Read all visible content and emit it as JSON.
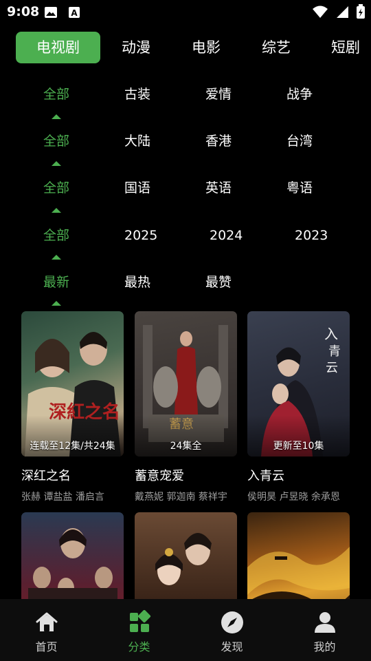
{
  "status_bar": {
    "time": "9:08",
    "left_icons": [
      "image-icon",
      "text-a-icon"
    ],
    "right_icons": [
      "wifi-icon",
      "signal-icon",
      "battery-icon"
    ]
  },
  "top_tabs": [
    {
      "label": "电视剧",
      "active": true
    },
    {
      "label": "动漫",
      "active": false
    },
    {
      "label": "电影",
      "active": false
    },
    {
      "label": "综艺",
      "active": false
    },
    {
      "label": "短剧",
      "active": false
    }
  ],
  "filters": [
    {
      "name": "genre",
      "options": [
        "全部",
        "古装",
        "爱情",
        "战争"
      ],
      "selected": 0
    },
    {
      "name": "region",
      "options": [
        "全部",
        "大陆",
        "香港",
        "台湾"
      ],
      "selected": 0
    },
    {
      "name": "language",
      "options": [
        "全部",
        "国语",
        "英语",
        "粤语"
      ],
      "selected": 0
    },
    {
      "name": "year",
      "options": [
        "全部",
        "2025",
        "2024",
        "2023"
      ],
      "selected": 0
    },
    {
      "name": "sort",
      "options": [
        "最新",
        "最热",
        "最赞"
      ],
      "selected": 0
    }
  ],
  "cards": [
    {
      "title": "深红之名",
      "badge": "连载至12集/共24集",
      "cast": "张赫  谭盐盐  潘启言",
      "colors": [
        "#3a5a4a",
        "#c8b8a0"
      ]
    },
    {
      "title": "蓄意宠爱",
      "badge": "24集全",
      "cast": "戴燕妮  郭迦南  蔡祥宇",
      "colors": [
        "#3b3532",
        "#7a2a2a"
      ]
    },
    {
      "title": "入青云",
      "badge": "更新至10集",
      "cast": "侯明昊  卢昱晓  余承恩",
      "colors": [
        "#2e3444",
        "#8a2a3a"
      ]
    },
    {
      "title": "",
      "badge": "",
      "cast": "",
      "colors": [
        "#2a3a50",
        "#a03030"
      ]
    },
    {
      "title": "",
      "badge": "",
      "cast": "",
      "colors": [
        "#5a3a2a",
        "#e8d0b0"
      ]
    },
    {
      "title": "",
      "badge": "",
      "cast": "",
      "colors": [
        "#4a2a10",
        "#e09020"
      ]
    }
  ],
  "bottom_nav": [
    {
      "label": "首页",
      "icon": "home-icon",
      "active": false
    },
    {
      "label": "分类",
      "icon": "category-grid-icon",
      "active": true
    },
    {
      "label": "发现",
      "icon": "compass-icon",
      "active": false
    },
    {
      "label": "我的",
      "icon": "person-icon",
      "active": false
    }
  ],
  "colors": {
    "accent": "#4caf50",
    "background": "#000000",
    "muted_text": "#9e9e9e"
  }
}
